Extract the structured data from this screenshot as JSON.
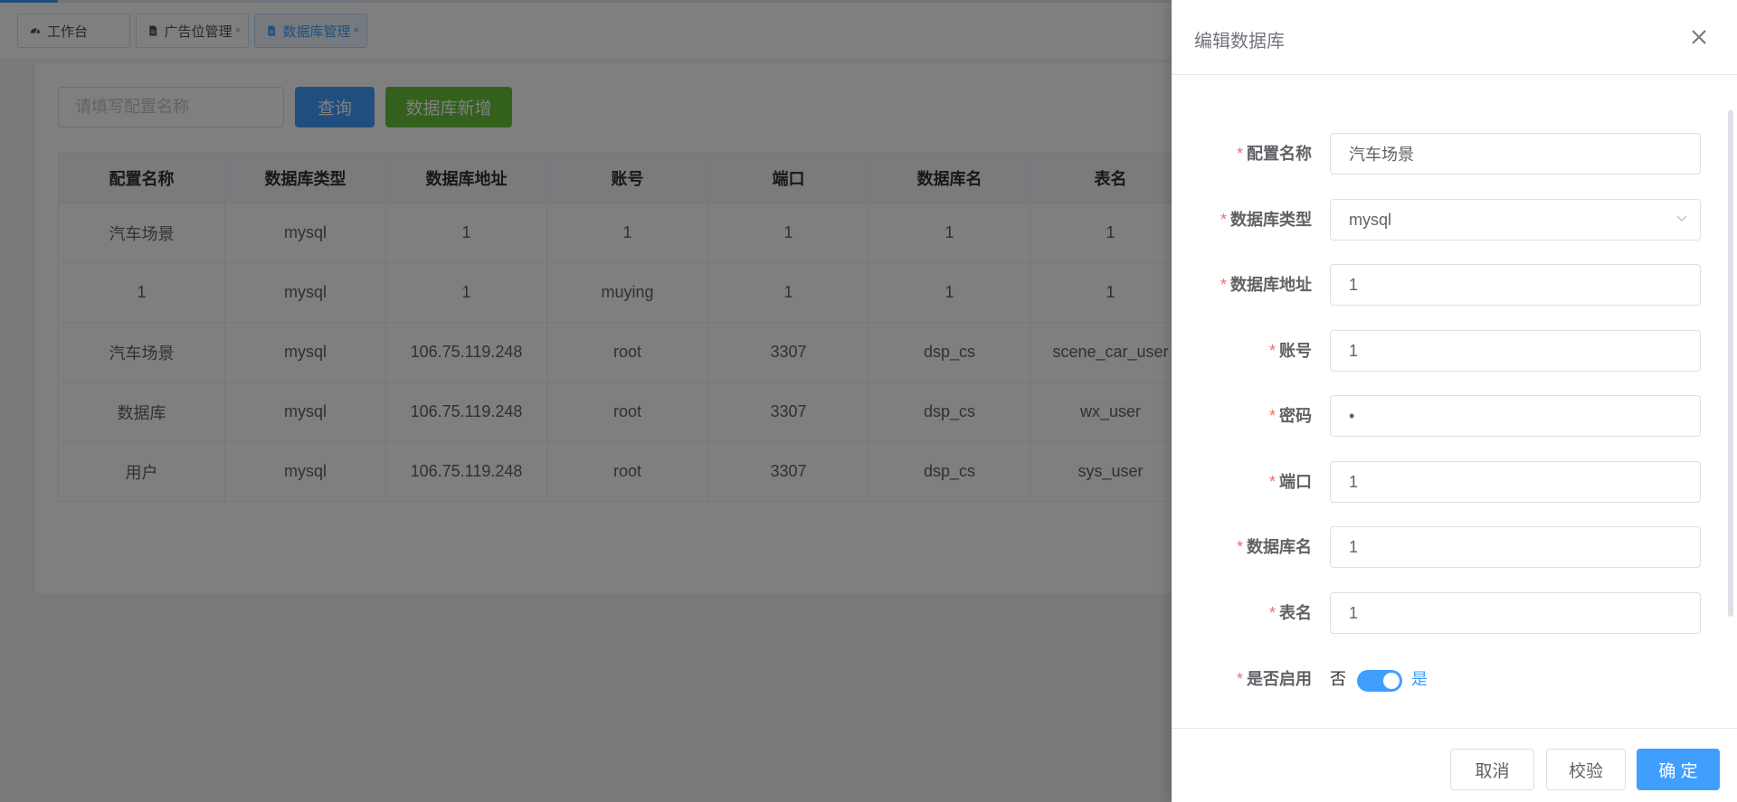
{
  "tabs": [
    {
      "label": "工作台",
      "icon": "dashboard-icon",
      "closable": false
    },
    {
      "label": "广告位管理",
      "icon": "document-icon",
      "closable": true
    },
    {
      "label": "数据库管理",
      "icon": "document-icon",
      "closable": true,
      "active": true
    }
  ],
  "toolbar": {
    "search_placeholder": "请填写配置名称",
    "query_label": "查询",
    "add_label": "数据库新增"
  },
  "table": {
    "columns": [
      "配置名称",
      "数据库类型",
      "数据库地址",
      "账号",
      "端口",
      "数据库名",
      "表名"
    ],
    "rows": [
      [
        "汽车场景",
        "mysql",
        "1",
        "1",
        "1",
        "1",
        "1"
      ],
      [
        "1",
        "mysql",
        "1",
        "muying",
        "1",
        "1",
        "1"
      ],
      [
        "汽车场景",
        "mysql",
        "106.75.119.248",
        "root",
        "3307",
        "dsp_cs",
        "scene_car_user"
      ],
      [
        "数据库",
        "mysql",
        "106.75.119.248",
        "root",
        "3307",
        "dsp_cs",
        "wx_user"
      ],
      [
        "用户",
        "mysql",
        "106.75.119.248",
        "root",
        "3307",
        "dsp_cs",
        "sys_user"
      ]
    ]
  },
  "drawer": {
    "title": "编辑数据库",
    "fields": {
      "config_name": {
        "label": "配置名称",
        "value": "汽车场景"
      },
      "db_type": {
        "label": "数据库类型",
        "value": "mysql"
      },
      "db_address": {
        "label": "数据库地址",
        "value": "1"
      },
      "account": {
        "label": "账号",
        "value": "1"
      },
      "password": {
        "label": "密码",
        "value": "•"
      },
      "port": {
        "label": "端口",
        "value": "1"
      },
      "db_name": {
        "label": "数据库名",
        "value": "1"
      },
      "table_name": {
        "label": "表名",
        "value": "1"
      }
    },
    "enabled": {
      "label": "是否启用",
      "off_text": "否",
      "on_text": "是",
      "value": true
    },
    "required_mark": "*",
    "footer": {
      "cancel": "取消",
      "validate": "校验",
      "confirm": "确 定"
    }
  },
  "colors": {
    "primary": "#409eff",
    "success": "#67c23a",
    "danger": "#f56c6c"
  }
}
